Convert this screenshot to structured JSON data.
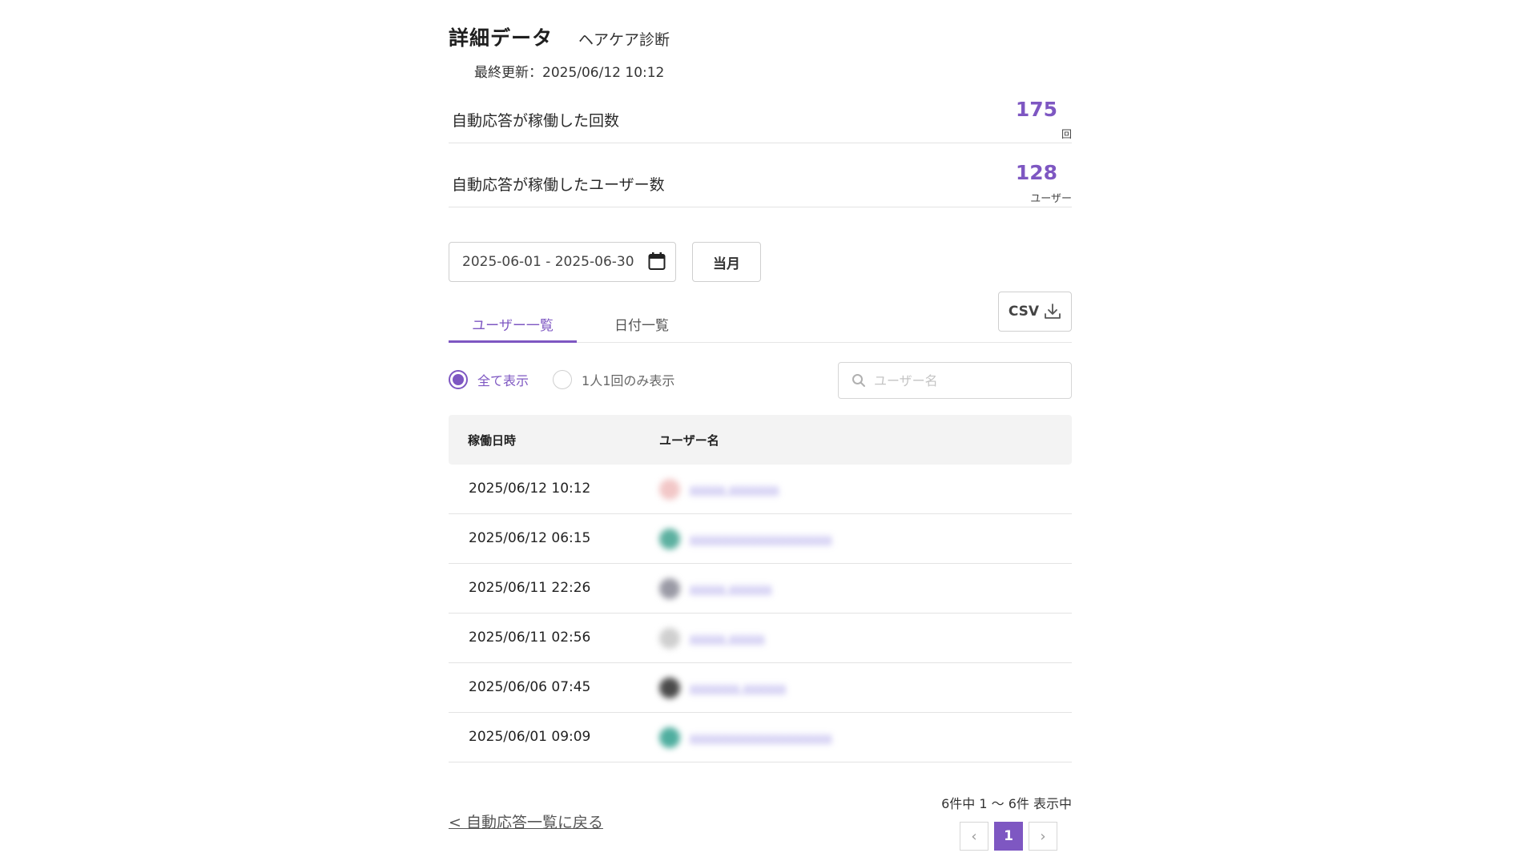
{
  "header": {
    "title": "詳細データ",
    "subtitle": "ヘアケア診断",
    "last_updated": "最終更新：2025/06/12 10:12"
  },
  "stats": [
    {
      "label": "自動応答が稼働した回数",
      "value": "175",
      "unit": "回"
    },
    {
      "label": "自動応答が稼働したユーザー数",
      "value": "128",
      "unit": "ユーザー"
    }
  ],
  "filters": {
    "date_range": "2025-06-01 - 2025-06-30",
    "current_month_label": "当月",
    "csv_label": "CSV"
  },
  "tabs": [
    {
      "label": "ユーザー一覧",
      "active": true
    },
    {
      "label": "日付一覧",
      "active": false
    }
  ],
  "radio": {
    "all_label": "全て表示",
    "once_label": "1人1回のみ表示"
  },
  "search": {
    "placeholder": "ユーザー名"
  },
  "table": {
    "headers": [
      "稼働日時",
      "ユーザー名"
    ],
    "rows": [
      {
        "date": "2025/06/12 10:12",
        "user": "xxxxx xxxxxxx",
        "avatar_color": "#f2c7c7"
      },
      {
        "date": "2025/06/12 06:15",
        "user": "xxxxxxxxxxxxxxxxxxxx",
        "avatar_color": "#5cb0a0"
      },
      {
        "date": "2025/06/11 22:26",
        "user": "xxxxx xxxxxx",
        "avatar_color": "#9a9aa5"
      },
      {
        "date": "2025/06/11 02:56",
        "user": "xxxxx xxxxx",
        "avatar_color": "#cfcfcf"
      },
      {
        "date": "2025/06/06 07:45",
        "user": "xxxxxxx xxxxxx",
        "avatar_color": "#4a4a4a"
      },
      {
        "date": "2025/06/01 09:09",
        "user": "xxxxxxxxxxxxxxxxxxxx",
        "avatar_color": "#4fae9f"
      }
    ]
  },
  "footer": {
    "back_link": "< 自動応答一覧に戻る",
    "page_info": "6件中 1 〜 6件 表示中",
    "current_page": "1",
    "prev_symbol": "‹",
    "next_symbol": "›"
  },
  "colors": {
    "accent": "#7e57c2",
    "border": "#e3e3e3",
    "header_bg": "#f3f3f3"
  }
}
